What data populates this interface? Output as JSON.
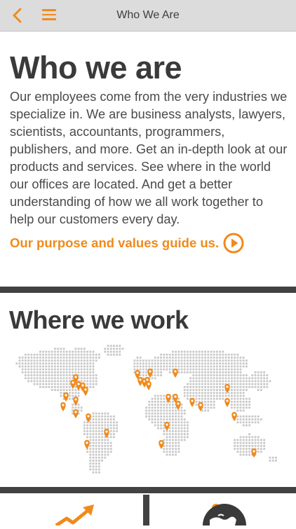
{
  "nav": {
    "title": "Who We Are",
    "accent": "#f08a1c"
  },
  "intro": {
    "heading": "Who we are",
    "body": "Our employees come from the very industries we specialize in. We are business analysts, lawyers, scientists, accountants, programmers, publishers, and more. Get an in-depth look at our products and services. See where in the world our offices are located. And get a better understanding of how we all work together to help our customers every day.",
    "cta_label": "Our purpose and values guide us."
  },
  "offices": {
    "heading": "Where we work",
    "pin_count": 30
  },
  "tiles": [
    {
      "icon": "growth-chart-icon"
    },
    {
      "icon": "globe-icon"
    }
  ],
  "colors": {
    "accent": "#f08a1c",
    "dark": "#424242",
    "map_dot": "#c8c8c8"
  }
}
